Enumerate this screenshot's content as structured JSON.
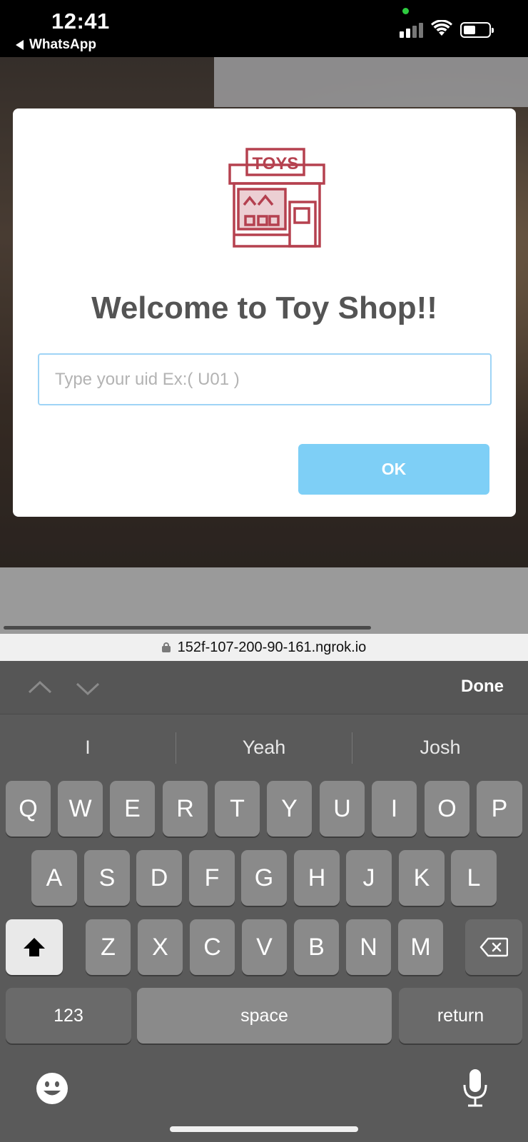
{
  "status_bar": {
    "time": "12:41",
    "back_app": "WhatsApp"
  },
  "modal": {
    "title": "Welcome to Toy Shop!!",
    "logo_text": "TOYS",
    "uid_placeholder": "Type your uid Ex:( U01 )",
    "uid_value": "",
    "ok_label": "OK",
    "accent_color": "#7ecff6"
  },
  "browser": {
    "url": "152f-107-200-90-161.ngrok.io"
  },
  "keyboard": {
    "done_label": "Done",
    "suggestions": [
      "I",
      "Yeah",
      "Josh"
    ],
    "row1": [
      "Q",
      "W",
      "E",
      "R",
      "T",
      "Y",
      "U",
      "I",
      "O",
      "P"
    ],
    "row2": [
      "A",
      "S",
      "D",
      "F",
      "G",
      "H",
      "J",
      "K",
      "L"
    ],
    "row3": [
      "Z",
      "X",
      "C",
      "V",
      "B",
      "N",
      "M"
    ],
    "numbers_label": "123",
    "space_label": "space",
    "return_label": "return"
  }
}
